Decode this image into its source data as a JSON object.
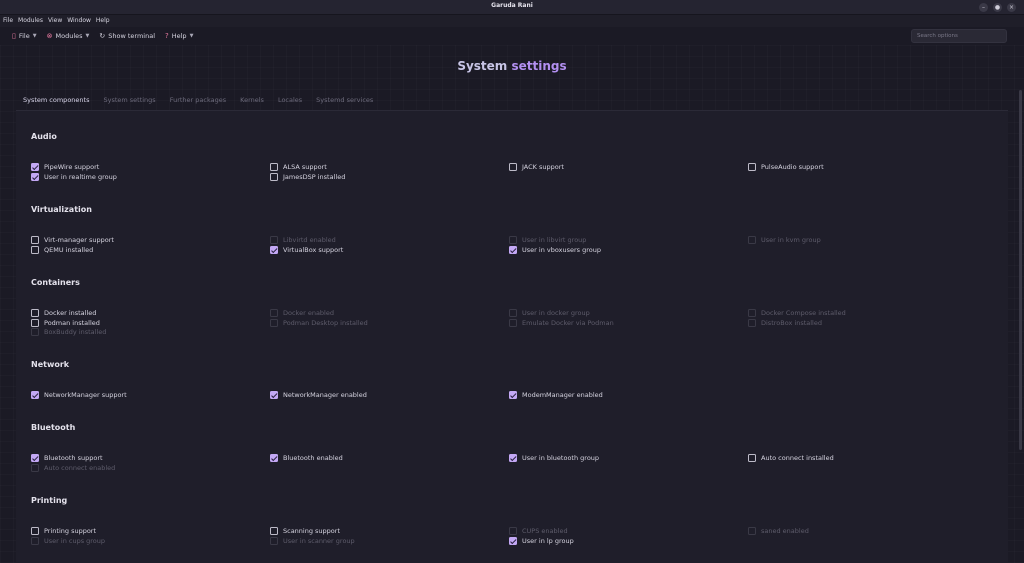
{
  "window": {
    "title": "Garuda Rani",
    "controls": [
      "–",
      "●",
      "×"
    ]
  },
  "menubar": [
    "File",
    "Modules",
    "View",
    "Window",
    "Help"
  ],
  "toolbar": {
    "file": "File",
    "modules": "Modules",
    "terminal": "Show terminal",
    "help": "Help",
    "search_placeholder": "Search options"
  },
  "page": {
    "title_part1": "System",
    "title_part2": "settings"
  },
  "tabs": [
    "System components",
    "System settings",
    "Further packages",
    "Kernels",
    "Locales",
    "Systemd services"
  ],
  "accent_color": "#b28ff0",
  "sections": [
    {
      "title": "Audio",
      "items": [
        {
          "label": "PipeWire support",
          "checked": true,
          "enabled": true
        },
        {
          "label": "User in realtime group",
          "checked": true,
          "enabled": true
        },
        {
          "label": "ALSA support",
          "checked": false,
          "enabled": true
        },
        {
          "label": "JamesDSP installed",
          "checked": false,
          "enabled": true
        },
        {
          "label": "JACK support",
          "checked": false,
          "enabled": true
        },
        {
          "label": "PulseAudio support",
          "checked": false,
          "enabled": true
        }
      ]
    },
    {
      "title": "Virtualization",
      "items": [
        {
          "label": "Virt-manager support",
          "checked": false,
          "enabled": true
        },
        {
          "label": "QEMU installed",
          "checked": false,
          "enabled": true
        },
        {
          "label": "Libvirtd enabled",
          "checked": false,
          "enabled": false
        },
        {
          "label": "VirtualBox support",
          "checked": true,
          "enabled": true
        },
        {
          "label": "User in libvirt group",
          "checked": false,
          "enabled": false
        },
        {
          "label": "User in vboxusers group",
          "checked": true,
          "enabled": true
        },
        {
          "label": "User in kvm group",
          "checked": false,
          "enabled": false
        }
      ]
    },
    {
      "title": "Containers",
      "items": [
        {
          "label": "Docker installed",
          "checked": false,
          "enabled": true
        },
        {
          "label": "Podman installed",
          "checked": false,
          "enabled": true
        },
        {
          "label": "BoxBuddy installed",
          "checked": false,
          "enabled": false
        },
        {
          "label": "Docker enabled",
          "checked": false,
          "enabled": false
        },
        {
          "label": "Podman Desktop installed",
          "checked": false,
          "enabled": false
        },
        {
          "label": "User in docker group",
          "checked": false,
          "enabled": false
        },
        {
          "label": "Emulate Docker via Podman",
          "checked": false,
          "enabled": false
        },
        {
          "label": "Docker Compose installed",
          "checked": false,
          "enabled": false
        },
        {
          "label": "DistroBox installed",
          "checked": false,
          "enabled": false
        }
      ]
    },
    {
      "title": "Network",
      "items": [
        {
          "label": "NetworkManager support",
          "checked": true,
          "enabled": true
        },
        {
          "label": "NetworkManager enabled",
          "checked": true,
          "enabled": true
        },
        {
          "label": "ModemManager enabled",
          "checked": true,
          "enabled": true
        }
      ]
    },
    {
      "title": "Bluetooth",
      "items": [
        {
          "label": "Bluetooth support",
          "checked": true,
          "enabled": true
        },
        {
          "label": "Auto connect enabled",
          "checked": false,
          "enabled": false
        },
        {
          "label": "Bluetooth enabled",
          "checked": true,
          "enabled": true
        },
        {
          "label": "User in bluetooth group",
          "checked": true,
          "enabled": true
        },
        {
          "label": "Auto connect installed",
          "checked": false,
          "enabled": true
        }
      ]
    },
    {
      "title": "Printing",
      "items": [
        {
          "label": "Printing support",
          "checked": false,
          "enabled": true
        },
        {
          "label": "User in cups group",
          "checked": false,
          "enabled": false
        },
        {
          "label": "Scanning support",
          "checked": false,
          "enabled": true
        },
        {
          "label": "User in scanner group",
          "checked": false,
          "enabled": false
        },
        {
          "label": "CUPS enabled",
          "checked": false,
          "enabled": false
        },
        {
          "label": "User in lp group",
          "checked": true,
          "enabled": true
        },
        {
          "label": "saned enabled",
          "checked": false,
          "enabled": false
        }
      ]
    }
  ]
}
